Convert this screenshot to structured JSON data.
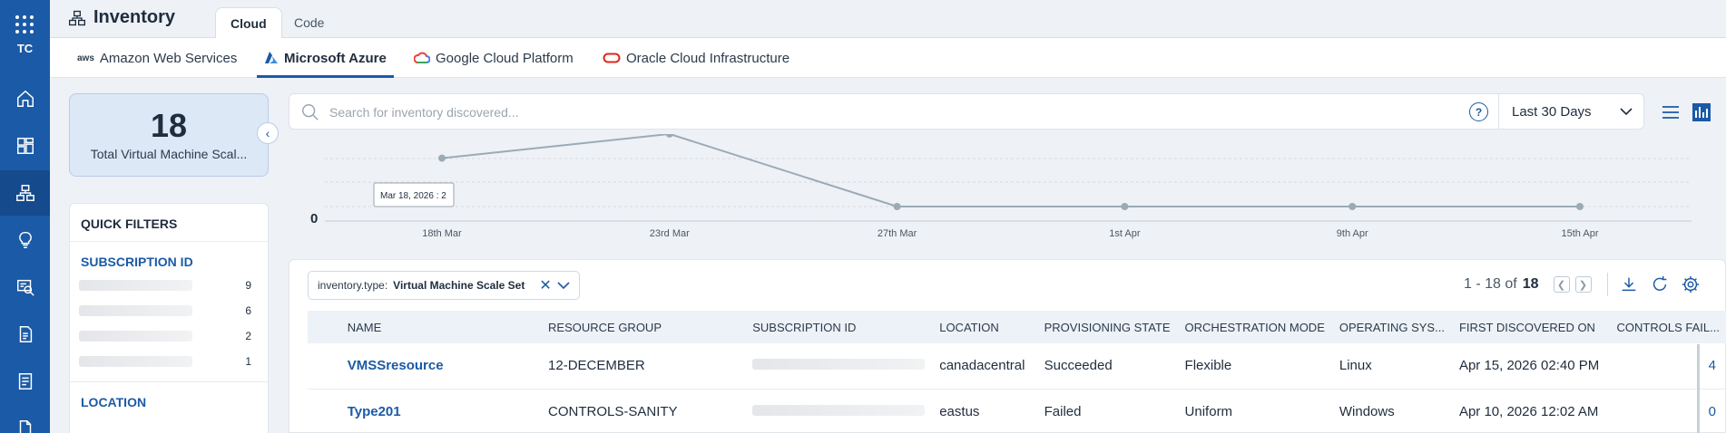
{
  "rail": {
    "brand": "TC",
    "items": [
      "home-icon",
      "dashboard-icon",
      "inventory-icon",
      "insights-icon",
      "search-report-icon",
      "policy-icon",
      "reports-icon",
      "file-icon"
    ]
  },
  "header": {
    "title": "Inventory",
    "tabs": [
      {
        "label": "Cloud",
        "active": true
      },
      {
        "label": "Code",
        "active": false
      }
    ]
  },
  "providers": [
    {
      "label": "Amazon Web Services",
      "logo": "aws",
      "active": false
    },
    {
      "label": "Microsoft Azure",
      "logo": "azure",
      "active": true
    },
    {
      "label": "Google Cloud Platform",
      "logo": "gcp",
      "active": false
    },
    {
      "label": "Oracle Cloud Infrastructure",
      "logo": "oracle",
      "active": false
    }
  ],
  "stat": {
    "value": "18",
    "label": "Total Virtual Machine Scal..."
  },
  "quick_filters": {
    "title": "QUICK FILTERS",
    "sections": [
      {
        "title": "SUBSCRIPTION ID",
        "rows": [
          {
            "count": "9"
          },
          {
            "count": "6"
          },
          {
            "count": "2"
          },
          {
            "count": "1"
          }
        ]
      },
      {
        "title": "LOCATION",
        "rows": []
      }
    ]
  },
  "search": {
    "placeholder": "Search for inventory discovered...",
    "value": ""
  },
  "date_range": {
    "selected": "Last 30 Days"
  },
  "chart_data": {
    "type": "line",
    "x": [
      "18th Mar",
      "23rd Mar",
      "27th Mar",
      "1st Apr",
      "9th Apr",
      "15th Apr"
    ],
    "series": [
      {
        "values": [
          2,
          3,
          0,
          0,
          0,
          0
        ]
      }
    ],
    "ytick": "0",
    "tooltip": "Mar 18, 2026 : 2",
    "color": "#9aabb6",
    "grid": "dashed horizontal"
  },
  "filter_chip": {
    "key": "inventory.type:",
    "value": "Virtual Machine Scale Set"
  },
  "pager": {
    "range": "1 - 18 of",
    "total": "18"
  },
  "table": {
    "columns": [
      "NAME",
      "RESOURCE GROUP",
      "SUBSCRIPTION ID",
      "LOCATION",
      "PROVISIONING STATE",
      "ORCHESTRATION MODE",
      "OPERATING SYS...",
      "FIRST DISCOVERED ON",
      "CONTROLS FAIL..."
    ],
    "rows": [
      {
        "name": "VMSSresource",
        "resource_group": "12-DECEMBER",
        "location": "canadacentral",
        "provisioning_state": "Succeeded",
        "orchestration_mode": "Flexible",
        "os": "Linux",
        "first_discovered": "Apr 15, 2026 02:40 PM",
        "controls_failed": "4"
      },
      {
        "name": "Type201",
        "resource_group": "CONTROLS-SANITY",
        "location": "eastus",
        "provisioning_state": "Failed",
        "orchestration_mode": "Uniform",
        "os": "Windows",
        "first_discovered": "Apr 10, 2026 12:02 AM",
        "controls_failed": "0"
      }
    ]
  },
  "colors": {
    "rail": "#1b5aa6",
    "accent": "#1b5aa6",
    "card": "#dce8f6"
  }
}
